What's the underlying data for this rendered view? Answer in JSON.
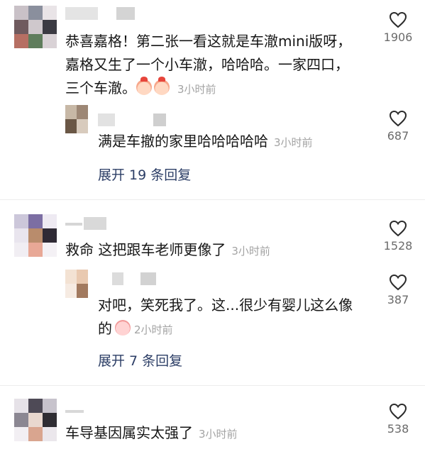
{
  "comments": [
    {
      "text_line1": "恭喜嘉格！第二张一看这就是车澈mini版呀，",
      "text_line2": "嘉格又生了一个小车澈，哈哈哈。一家四口，",
      "text_line3": "三个车澈。",
      "emojis": [
        "peach-face-emoji",
        "peach-face-emoji"
      ],
      "time": "3小时前",
      "likes": "1906",
      "reply": {
        "text": "满是车撤的家里哈哈哈哈哈",
        "time": "3小时前",
        "likes": "687"
      },
      "expand": "展开 19 条回复"
    },
    {
      "text": "救命 这把跟车老师更像了",
      "time": "3小时前",
      "likes": "1528",
      "reply": {
        "text_line1": "对吧，笑死我了。这...很少有婴儿这么像",
        "text_line2": "的",
        "emojis": [
          "crying-laugh-emoji"
        ],
        "time": "2小时前",
        "likes": "387"
      },
      "expand": "展开 7 条回复"
    },
    {
      "text": "车导基因属实太强了",
      "time": "3小时前",
      "likes": "538"
    }
  ],
  "colors": {
    "text": "#161616",
    "time": "#a3a3a3",
    "expand": "#2c3e66",
    "like_count": "#6b6b6b"
  }
}
